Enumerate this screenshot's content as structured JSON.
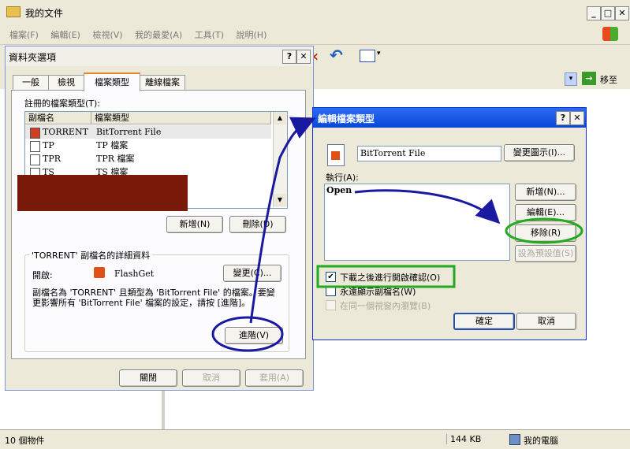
{
  "explorer": {
    "title": "我的文件",
    "menu": [
      "檔案(F)",
      "編輯(E)",
      "檢視(V)",
      "我的最愛(A)",
      "工具(T)",
      "說明(H)"
    ],
    "go_label": "移至",
    "status_objects": "10 個物件",
    "status_size": "144 KB",
    "status_location": "我的電腦"
  },
  "folder_options": {
    "title": "資料夾選項",
    "tabs": [
      "一般",
      "檢視",
      "檔案類型",
      "離線檔案"
    ],
    "active_tab": 2,
    "registered_label": "註冊的檔案類型(T):",
    "columns": [
      "副檔名",
      "檔案類型"
    ],
    "rows": [
      {
        "ext": "TORRENT",
        "type": "BitTorrent File",
        "selected": true
      },
      {
        "ext": "TP",
        "type": "TP 檔案"
      },
      {
        "ext": "TPR",
        "type": "TPR 檔案"
      },
      {
        "ext": "TS",
        "type": "TS 檔案"
      }
    ],
    "new_button": "新增(N)",
    "delete_button": "刪除(D)",
    "details_group": "'TORRENT' 副檔名的詳細資料",
    "opens_with_label": "開啟:",
    "opens_with_app": "FlashGet",
    "change_button": "變更(C)...",
    "description": "副檔名為 'TORRENT' 且類型為 'BitTorrent File' 的檔案。要變更影響所有 'BitTorrent File' 檔案的設定，請按 [進階]。",
    "advanced_button": "進階(V)",
    "close_button": "關閉",
    "cancel_button": "取消",
    "apply_button": "套用(A)"
  },
  "edit_file_type": {
    "title": "編輯檔案類型",
    "type_name": "BitTorrent File",
    "change_icon_button": "變更圖示(I)...",
    "actions_label": "執行(A):",
    "actions": [
      "Open"
    ],
    "new_button": "新增(N)...",
    "edit_button": "編輯(E)...",
    "remove_button": "移除(R)",
    "set_default_button": "設為預設值(S)",
    "options": [
      {
        "label": "下載之後進行開啟確認(O)",
        "checked": true,
        "disabled": false
      },
      {
        "label": "永遠顯示副檔名(W)",
        "checked": false,
        "disabled": false
      },
      {
        "label": "在同一個視窗內瀏覽(B)",
        "checked": false,
        "disabled": true
      }
    ],
    "ok_button": "確定",
    "cancel_button": "取消"
  },
  "annotation_colors": {
    "arrow": "#1a1aa0",
    "circle_blue": "#1a1aa0",
    "circle_green": "#22aa22",
    "redaction": "#7a1a0a"
  }
}
